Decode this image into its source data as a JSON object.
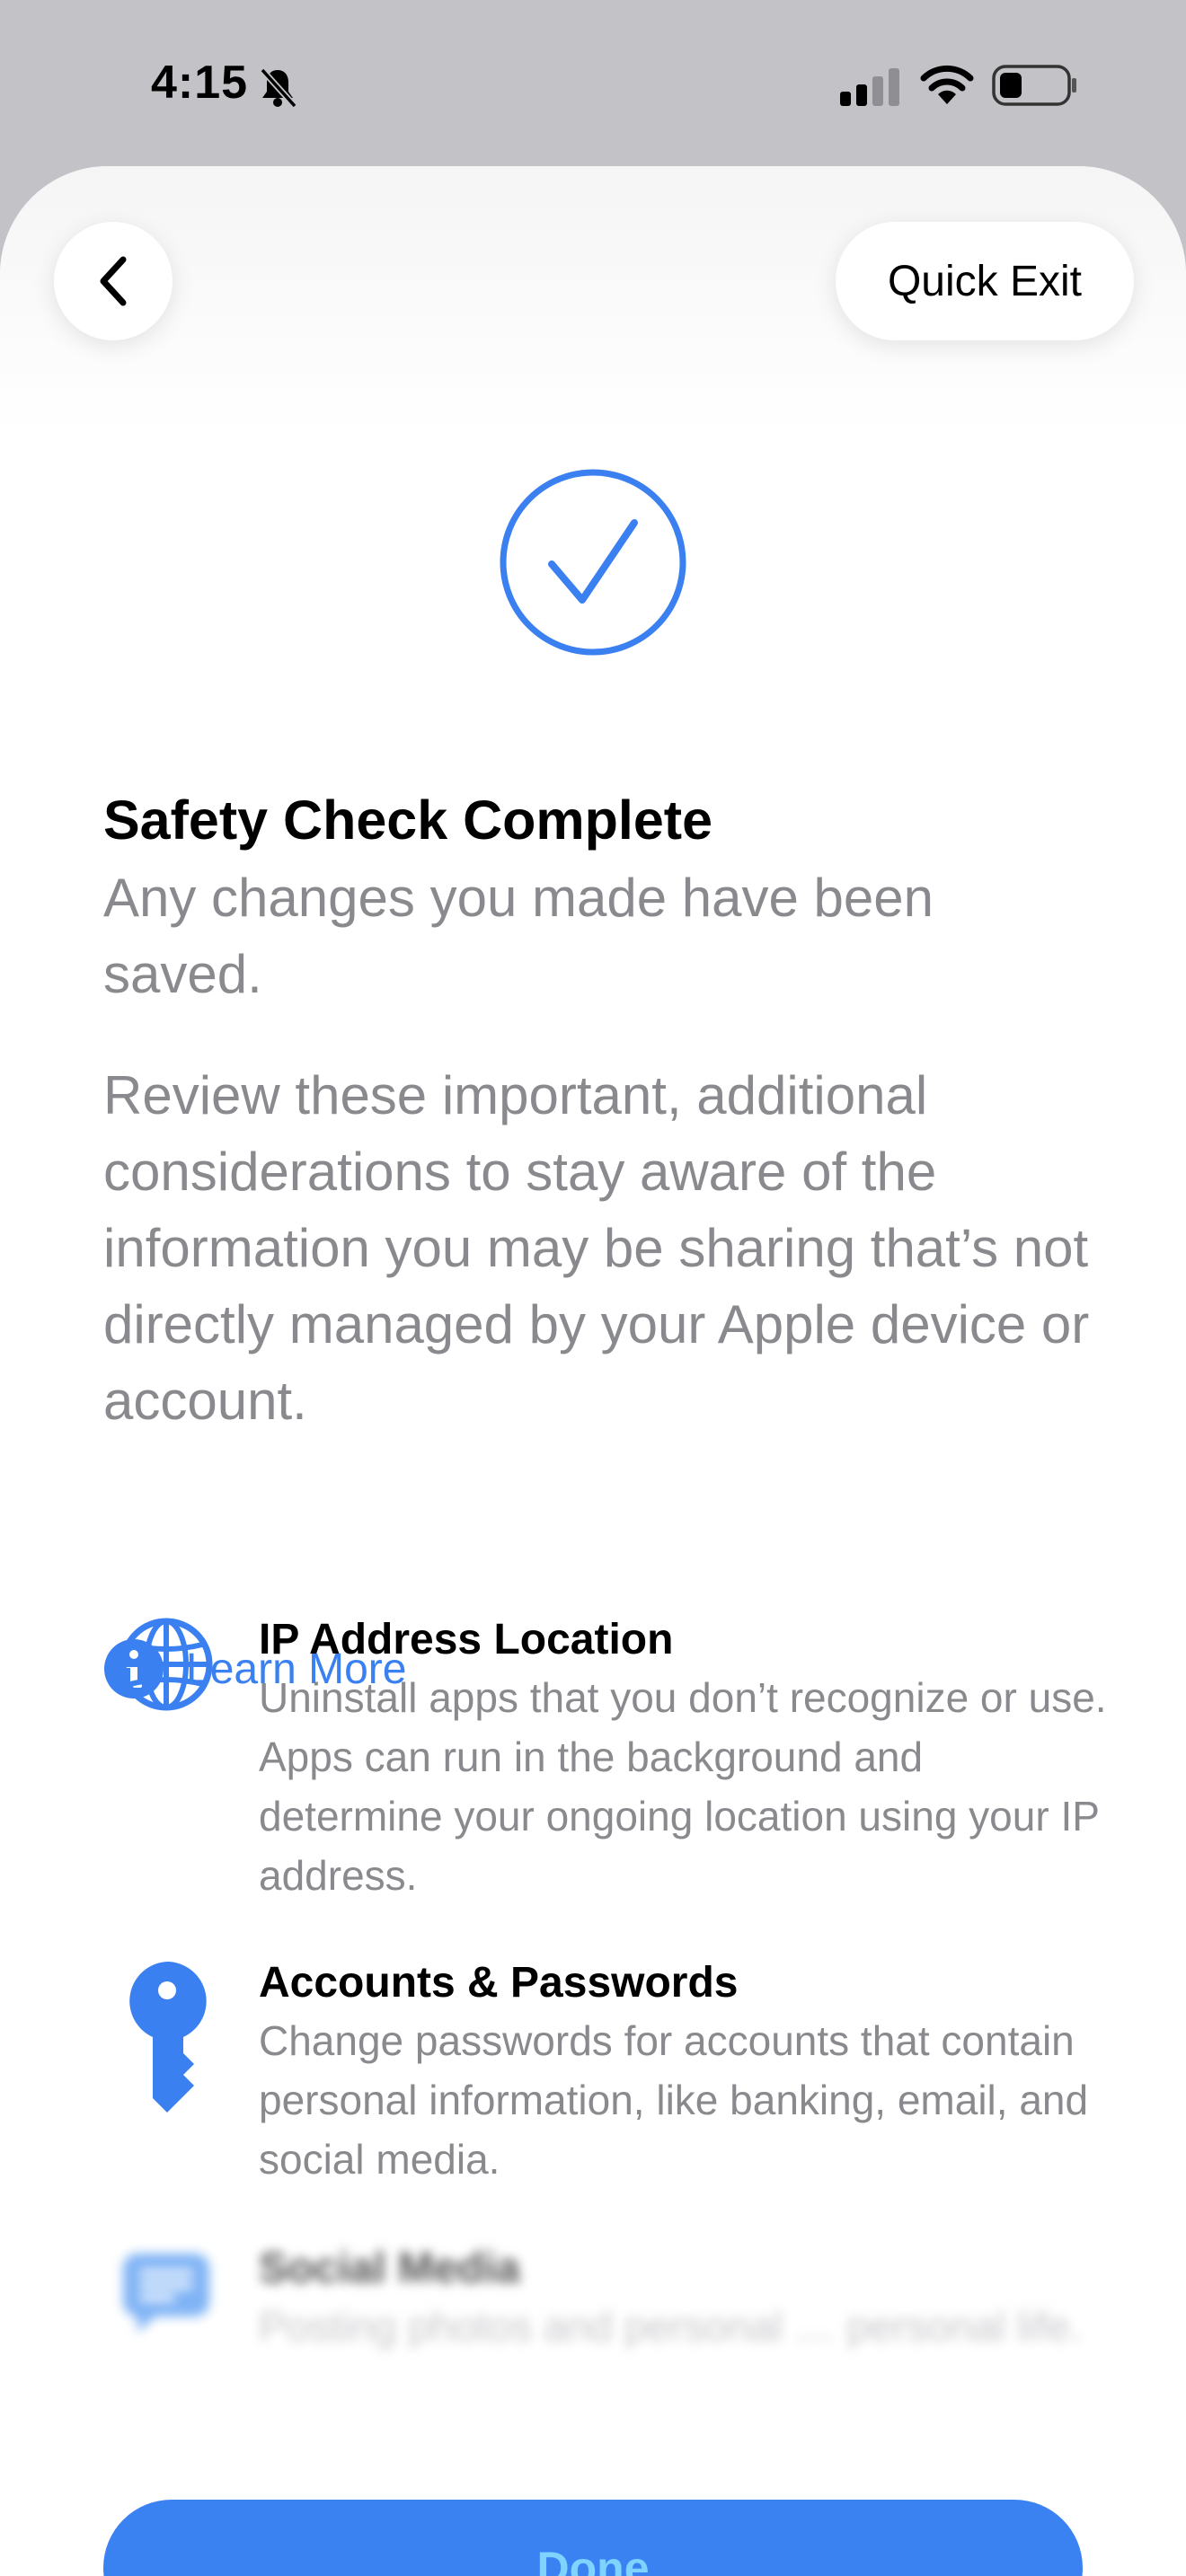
{
  "status_bar": {
    "time": "4:15",
    "icons": [
      "bell-slash-icon",
      "cellular-signal-icon",
      "wifi-icon",
      "battery-icon"
    ]
  },
  "header": {
    "back_icon": "chevron-left-icon",
    "quick_exit_label": "Quick Exit"
  },
  "hero_icon": "checkmark-circle-icon",
  "title": "Safety Check Complete",
  "subtitle": "Any changes you made have been saved.",
  "review_text": "Review these important, additional considerations to stay aware of the information you may be sharing that’s not directly managed by your Apple device or account.",
  "learn_more": {
    "icon": "info-circle-icon",
    "label": "Learn More"
  },
  "considerations": [
    {
      "icon": "globe-icon",
      "title": "IP Address Location",
      "description": "Uninstall apps that you don’t recognize or use. Apps can run in the background and determine your ongoing location using your IP address."
    },
    {
      "icon": "key-icon",
      "title": "Accounts & Passwords",
      "description": "Change passwords for accounts that contain personal information, like banking, email, and social media."
    },
    {
      "icon": "message-bubble-icon",
      "title": "Social Media",
      "description": "Posting photos and personal … personal life."
    }
  ],
  "done_label": "Done",
  "colors": {
    "accent": "#3a82f2",
    "done_text": "#7ed4ff",
    "secondary_text": "#8a8a8e",
    "status_bar_bg": "#c2c2c7"
  }
}
